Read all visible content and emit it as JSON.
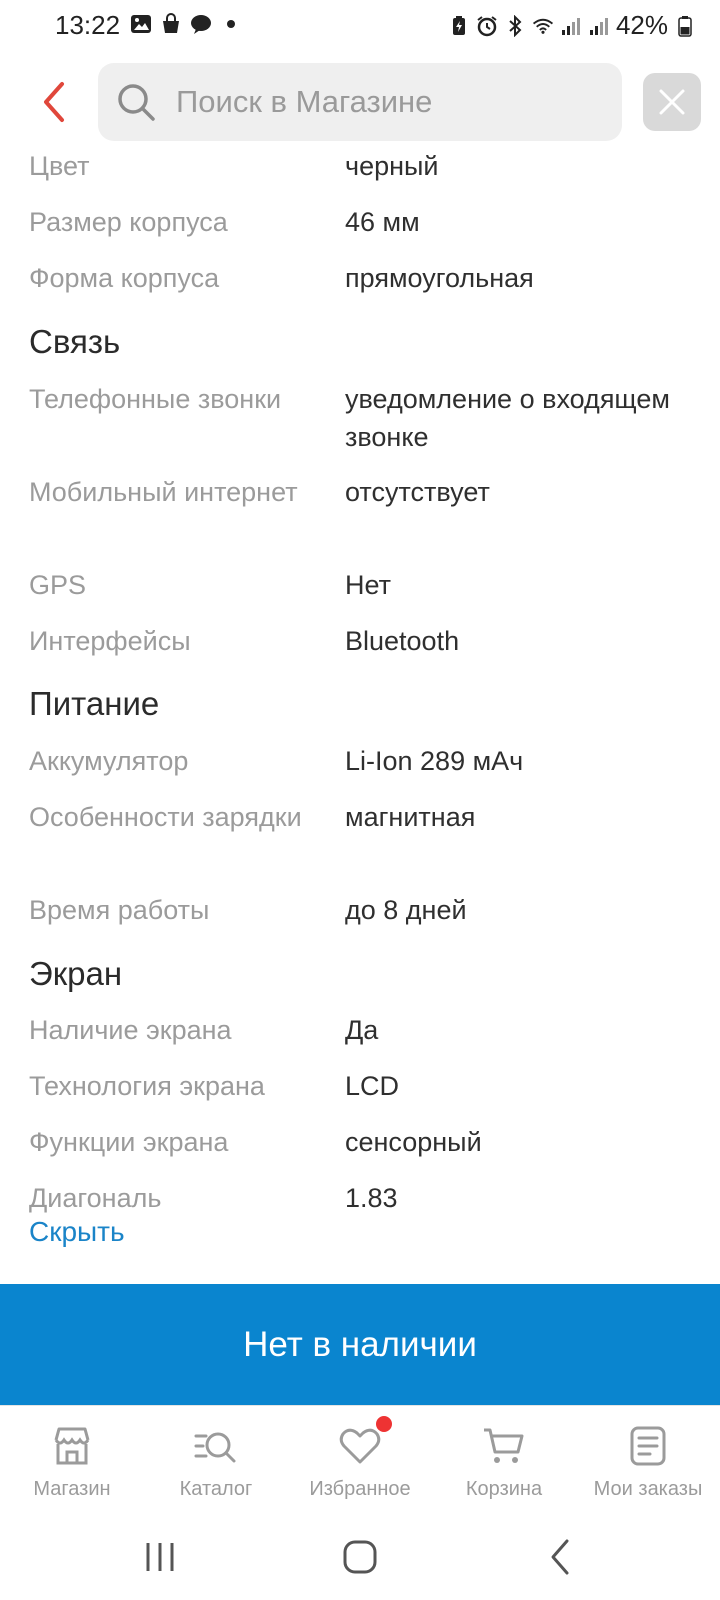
{
  "status_bar": {
    "time": "13:22",
    "battery": "42%",
    "left_icons": [
      "gallery-icon",
      "shopping-bag-icon",
      "chat-icon",
      "dot-icon"
    ],
    "right_icons": [
      "battery-saver-icon",
      "alarm-icon",
      "bluetooth-icon",
      "wifi-icon",
      "signal-icon",
      "signal-icon",
      "battery-icon"
    ]
  },
  "header": {
    "search_placeholder": "Поиск в Магазине",
    "accent_color": "#e0473b"
  },
  "specs": {
    "rows_top": [
      {
        "label": "Цвет",
        "value": "черный"
      },
      {
        "label": "Размер корпуса",
        "value": "46 мм"
      },
      {
        "label": "Форма корпуса",
        "value": "прямоугольная"
      }
    ],
    "section_svyaz": "Связь",
    "svyaz": [
      {
        "label": "Телефонные звонки",
        "value": "уведомление о входящем звонке"
      },
      {
        "label": "Мобильный интернет",
        "value": "отсутствует"
      },
      {
        "label": "GPS",
        "value": "Нет"
      },
      {
        "label": "Интерфейсы",
        "value": "Bluetooth"
      }
    ],
    "section_pitanie": "Питание",
    "pitanie": [
      {
        "label": "Аккумулятор",
        "value": "Li-Ion 289 мАч"
      },
      {
        "label": "Особенности зарядки",
        "value": "магнитная"
      },
      {
        "label": "Время работы",
        "value": "до 8 дней"
      }
    ],
    "section_ekran": "Экран",
    "ekran": [
      {
        "label": "Наличие экрана",
        "value": "Да"
      },
      {
        "label": "Технология экрана",
        "value": "LCD"
      },
      {
        "label": "Функции экрана",
        "value": "сенсорный"
      },
      {
        "label": "Диагональ",
        "value": "1.83"
      }
    ],
    "hide_link": "Скрыть"
  },
  "action": {
    "label": "Нет в наличии",
    "color": "#0a85cf"
  },
  "bottom_nav": {
    "items": [
      {
        "label": "Магазин",
        "icon": "store-icon"
      },
      {
        "label": "Каталог",
        "icon": "catalog-search-icon"
      },
      {
        "label": "Избранное",
        "icon": "heart-icon",
        "badge": true
      },
      {
        "label": "Корзина",
        "icon": "cart-icon"
      },
      {
        "label": "Мои заказы",
        "icon": "orders-icon"
      }
    ]
  }
}
